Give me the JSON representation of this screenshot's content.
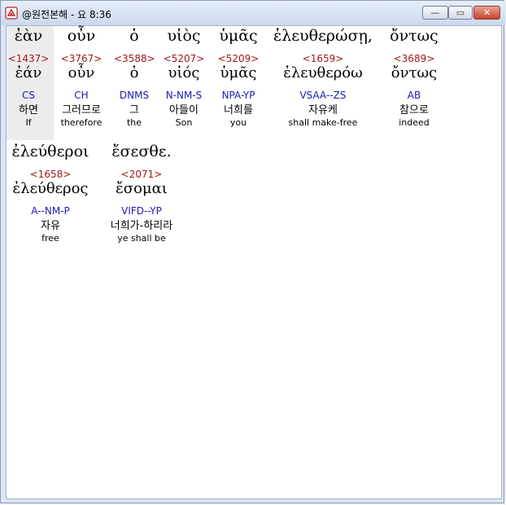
{
  "window": {
    "title": "@원전본해 - 요 8:36"
  },
  "controls": {
    "minimize": "—",
    "maximize": "▭",
    "close": "✕"
  },
  "words": [
    {
      "greek": "ἐὰν",
      "strong": "<1437>",
      "lemma": "ἐάν",
      "parse": "CS",
      "korean": "하면",
      "english": "If"
    },
    {
      "greek": "οὖν",
      "strong": "<3767>",
      "lemma": "οὖν",
      "parse": "CH",
      "korean": "그러므로",
      "english": "therefore"
    },
    {
      "greek": "ὁ",
      "strong": "<3588>",
      "lemma": "ὁ",
      "parse": "DNMS",
      "korean": "그",
      "english": "the"
    },
    {
      "greek": "υἱὸς",
      "strong": "<5207>",
      "lemma": "υἱός",
      "parse": "N-NM-S",
      "korean": "아들이",
      "english": "Son"
    },
    {
      "greek": "ὑμᾶς",
      "strong": "<5209>",
      "lemma": "ὑμᾶς",
      "parse": "NPA-YP",
      "korean": "너희를",
      "english": "you"
    },
    {
      "greek": "ἐλευθερώσῃ,",
      "strong": "<1659>",
      "lemma": "ἐλευθερόω",
      "parse": "VSAA--ZS",
      "korean": "자유케",
      "english": "shall make-free"
    },
    {
      "greek": "ὄντως",
      "strong": "<3689>",
      "lemma": "ὄντως",
      "parse": "AB",
      "korean": "참으로",
      "english": "indeed"
    },
    {
      "greek": "ἐλεύθεροι",
      "strong": "<1658>",
      "lemma": "ἐλεύθερος",
      "parse": "A--NM-P",
      "korean": "자유",
      "english": "free"
    },
    {
      "greek": "ἔσεσθε.",
      "strong": "<2071>",
      "lemma": "ἔσομαι",
      "parse": "VIFD--YP",
      "korean": "너희가-하리라",
      "english": "ye shall be"
    }
  ]
}
